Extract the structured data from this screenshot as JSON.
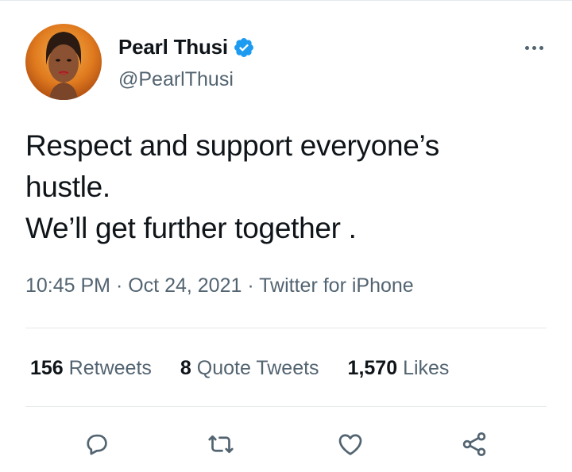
{
  "tweet": {
    "author_name": "Pearl Thusi",
    "author_handle": "@PearlThusi",
    "text_lines": [
      "Respect and support everyone’s",
      "hustle.",
      "We’ll get further together ."
    ],
    "time": "10:45 PM",
    "date": "Oct 24, 2021",
    "separator": " · ",
    "source": "Twitter for iPhone"
  },
  "stats": {
    "retweets_count": "156",
    "retweets_label": "Retweets",
    "quotes_count": "8",
    "quotes_label": "Quote Tweets",
    "likes_count": "1,570",
    "likes_label": "Likes"
  },
  "icons": {
    "verified": "verified-badge-icon",
    "more": "more-options-icon",
    "reply": "reply-icon",
    "retweet": "retweet-icon",
    "like": "heart-icon",
    "share": "share-icon"
  },
  "colors": {
    "verified_blue": "#1d9bf0",
    "text_primary": "#0f1419",
    "text_secondary": "#536471",
    "divider": "#e6e9eb"
  }
}
